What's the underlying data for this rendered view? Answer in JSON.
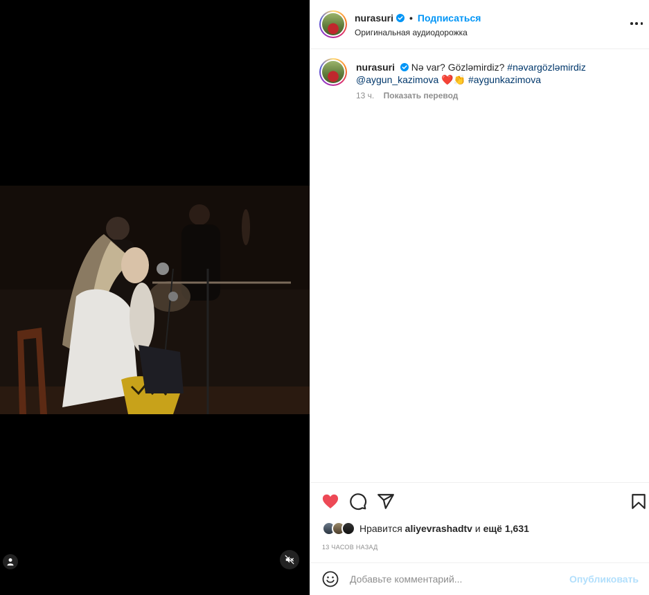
{
  "post": {
    "username": "nurasuri",
    "follow_label": "Подписаться",
    "dot": "•",
    "audio_label": "Оригинальная аудиодорожка"
  },
  "caption": {
    "username": "nurasuri",
    "text_start": "Nə var? Gözləmirdiz?",
    "hashtag1": "#nəvargözləmirdiz",
    "mention": "@aygun_kazimova",
    "emojis": "❤️👏",
    "hashtag2": "#aygunkazimova",
    "time": "13 ч.",
    "translate_label": "Показать перевод"
  },
  "likes": {
    "prefix": "Нравится",
    "user": "aliyevrashadtv",
    "and": "и",
    "more": "ещё 1,631"
  },
  "timestamp": "13 ЧАСОВ НАЗАД",
  "comment": {
    "placeholder": "Добавьте комментарий...",
    "publish_label": "Опубликовать"
  },
  "colors": {
    "link": "#0095f6",
    "like_red": "#ed4956",
    "publish_disabled": "#b2dffc"
  },
  "icons": [
    "verified-icon",
    "more-icon",
    "heart-icon",
    "comment-icon",
    "share-icon",
    "bookmark-icon",
    "emoji-icon",
    "user-tag-icon",
    "muted-icon"
  ]
}
